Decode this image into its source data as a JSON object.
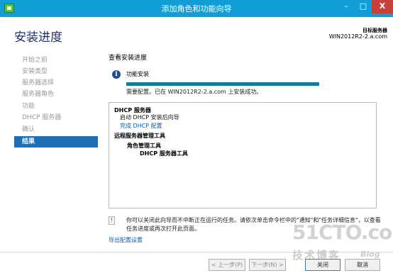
{
  "window": {
    "title": "添加角色和功能向导",
    "min_glyph": "–",
    "max_glyph": "□",
    "close_glyph": "X"
  },
  "header": {
    "page_title": "安装进度",
    "server_label": "目标服务器",
    "server_name": "WIN2012R2-2.a.com"
  },
  "steps": [
    {
      "label": "开始之前",
      "active": false
    },
    {
      "label": "安装类型",
      "active": false
    },
    {
      "label": "服务器选择",
      "active": false
    },
    {
      "label": "服务器角色",
      "active": false
    },
    {
      "label": "功能",
      "active": false
    },
    {
      "label": "DHCP 服务器",
      "active": false
    },
    {
      "label": "确认",
      "active": false
    },
    {
      "label": "结果",
      "active": true
    }
  ],
  "main": {
    "section_title": "查看安装进度",
    "info_glyph": "i",
    "feature_label": "功能安装",
    "progress": 1.0,
    "progress_message": "需要配置。已在 WIN2012R2-2.a.com 上安装成功。",
    "results": [
      {
        "text": "DHCP 服务器",
        "style": "bold",
        "indent": 0
      },
      {
        "text": "启动 DHCP 安装后向导",
        "style": "plain",
        "indent": 1
      },
      {
        "text": "完成 DHCP 配置",
        "style": "link",
        "indent": 1
      },
      {
        "text": "远程服务器管理工具",
        "style": "bold",
        "indent": 0
      },
      {
        "text": "角色管理工具",
        "style": "bold",
        "indent": 2
      },
      {
        "text": "DHCP 服务器工具",
        "style": "bold",
        "indent": 3
      }
    ],
    "note_text": "你可以关闭此向导而不中断正在运行的任务。请依次单击命令栏中的\"通知\"和\"任务详细信息\"，以查看任务进度或再次打开此页面。",
    "export_link": "导出配置设置"
  },
  "buttons": {
    "prev": "< 上一步(P)",
    "next": "下一步(N) >",
    "finish": "关闭",
    "cancel": "取消"
  },
  "watermark": {
    "main": "51CTO.com",
    "sub": "技术博客",
    "blog": "Blog"
  },
  "colors": {
    "titlebar": "#119ed6",
    "active_step": "#1f6fb5",
    "progress": "#117d9b",
    "link": "#0d5da7"
  }
}
